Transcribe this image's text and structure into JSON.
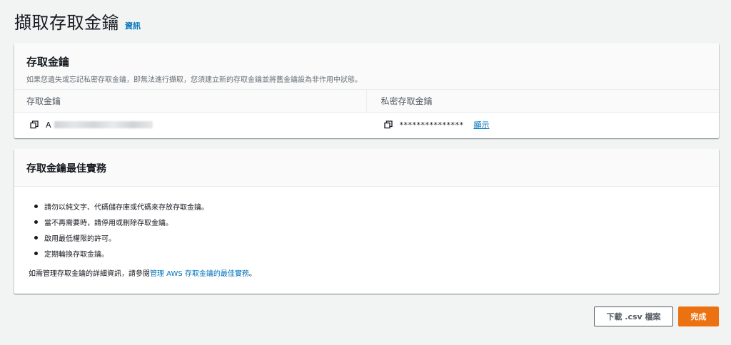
{
  "header": {
    "title": "擷取存取金鑰",
    "info_link": "資訊"
  },
  "access_key_panel": {
    "title": "存取金鑰",
    "description": "如果您遺失或忘記私密存取金鑰，即無法進行擷取，您須建立新的存取金鑰並將舊金鑰設為非作用中狀態。",
    "columns": {
      "access_key": "存取金鑰",
      "secret_key": "私密存取金鑰"
    },
    "access_key_value": "A",
    "secret_key_mask": "***************",
    "show_link": "顯示"
  },
  "best_practices_panel": {
    "title": "存取金鑰最佳實務",
    "items": [
      "請勿以純文字、代碼儲存庫或代碼來存放存取金鑰。",
      "當不再需要時，請停用或刪除存取金鑰。",
      "啟用最低權限的許可。",
      "定期輪換存取金鑰。"
    ],
    "footer_prefix": "如需管理存取金鑰的詳細資訊，請參閱",
    "footer_link": "管理 AWS 存取金鑰的最佳實務",
    "footer_suffix": "。"
  },
  "buttons": {
    "download_csv": "下載 .csv 檔案",
    "done": "完成"
  },
  "colors": {
    "link": "#0073bb",
    "primary_button": "#ec7211",
    "background": "#f2f3f3"
  }
}
